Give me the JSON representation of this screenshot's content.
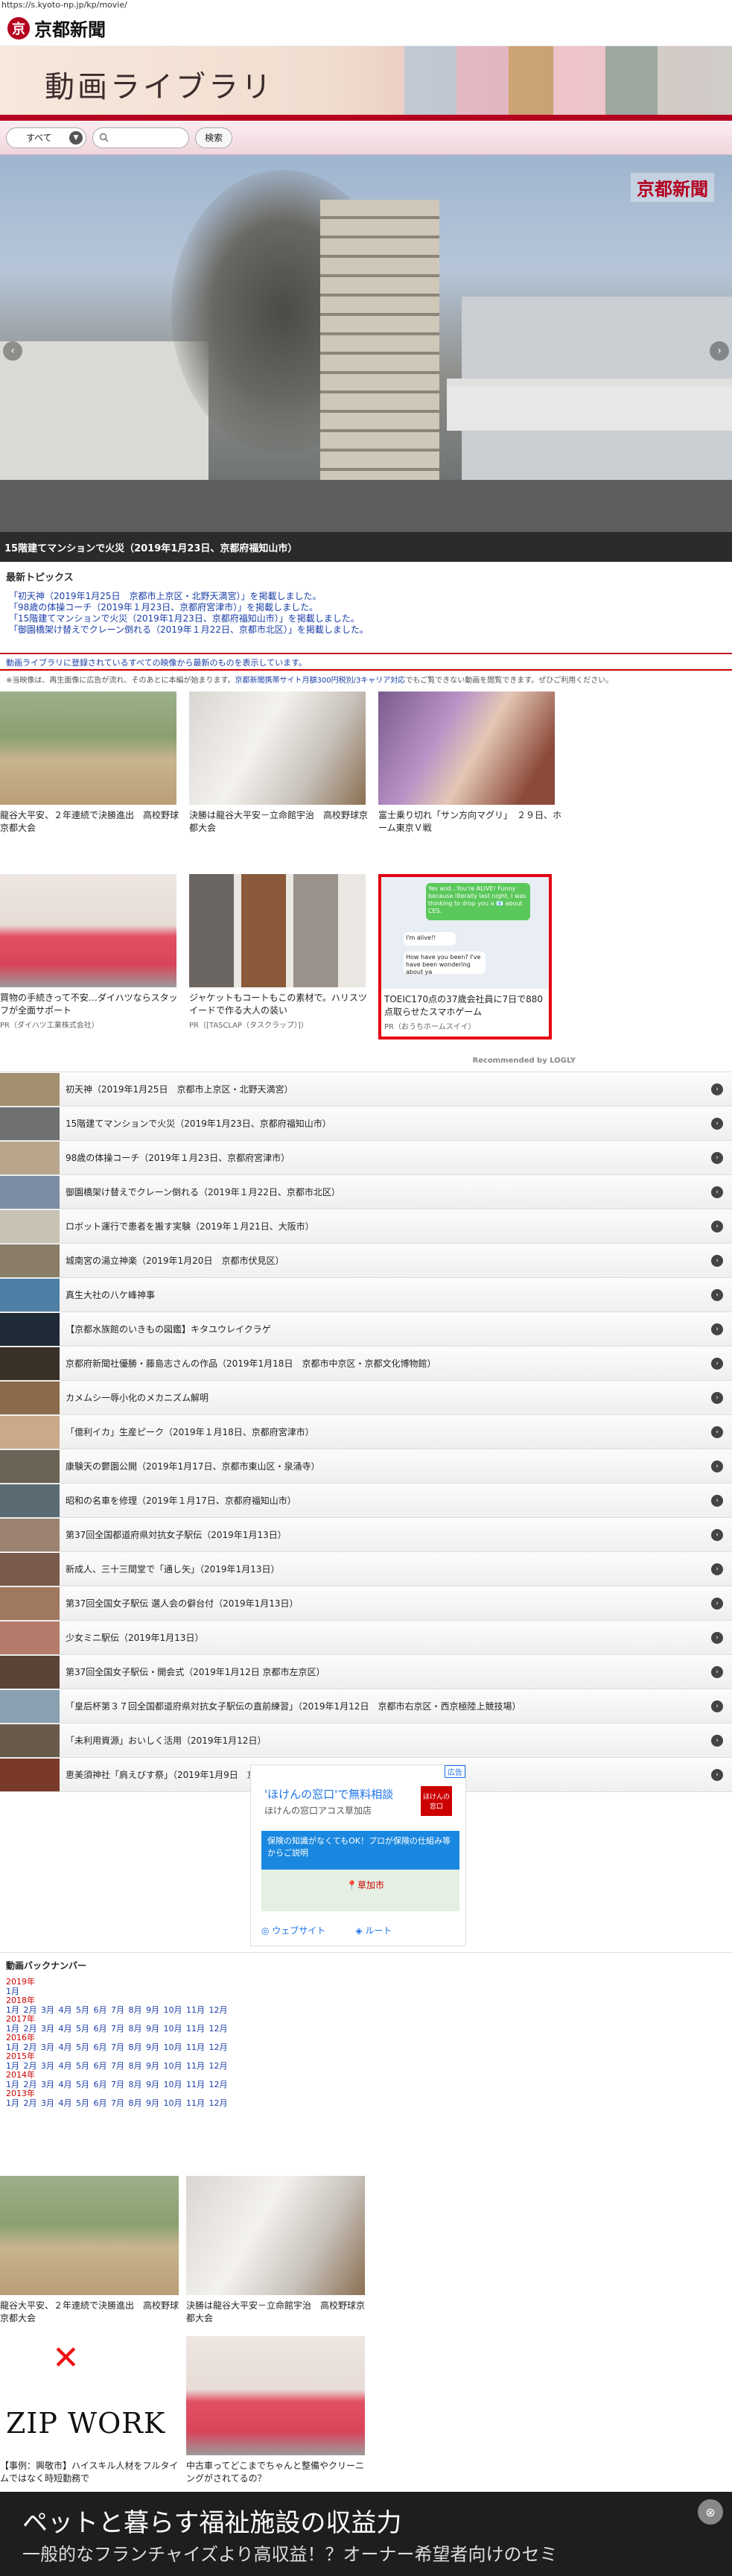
{
  "url": "https://s.kyoto-np.jp/kp/movie/",
  "brand": {
    "mark": "京",
    "name": "京都新聞"
  },
  "banner": {
    "title": "動画ライブラリ"
  },
  "filter": {
    "select_value": "すべて",
    "search_placeholder": "",
    "search_button": "検索"
  },
  "hero": {
    "logo": "京都新聞",
    "caption": "15階建てマンションで火災（2019年1月23日、京都府福知山市）",
    "prev": "‹",
    "next": "›"
  },
  "topics": {
    "title": "最新トピックス",
    "links": [
      "「初天神（2019年1月25日　京都市上京区・北野天満宮）」を掲載しました。",
      "「98歳の体操コーチ（2019年１月23日、京都府宮津市）」を掲載しました。",
      "「15階建てマンションで火災（2019年1月23日、京都府福知山市）」を掲載しました。",
      "「御園橋架け替えでクレーン倒れる（2019年１月22日、京都市北区）」を掲載しました。"
    ]
  },
  "notice": {
    "text": "※当映像は、再生面像に広告が流れ、そのあとに本編が始まります。",
    "link": "京都新聞携帯サイト月額300円税別/3キャリア対応",
    "tail": "でもご覧できない動画を閲覧できます。ぜひご利用ください。"
  },
  "notice_blue": "動画ライブラリに登録されているすべての映像から最新のものを表示しています。",
  "cards": [
    {
      "caption": "龍谷大平安、２年連続で決勝進出　高校野球京都大会",
      "pr": ""
    },
    {
      "caption": "決勝は龍谷大平安－立命館宇治　高校野球京都大会",
      "pr": ""
    },
    {
      "caption": "富士乗り切れ「サン方向マグリ」　２９日、ホーム東京Ｖ戦",
      "pr": ""
    },
    {
      "caption": "買物の手続きって不安…ダイハツならスタッフが全面サポート",
      "pr": "PR（ダイハツ工業株式会社）"
    },
    {
      "caption": "ジャケットもコートもこの素材で。ハリスツイードで作る大人の装い",
      "pr": "PR（[TASCLAP（タスクラップ）]）"
    },
    {
      "caption": "TOEIC170点の37歳会社員に7日で880点取らせたスマホゲーム",
      "pr": "PR（おうちホームスイイ）"
    }
  ],
  "chat_bubbles": [
    "Yes and...You're ALIVE! Funny because literally last night, I was thinking to drop you a 📧 about CES.",
    "I'm alive!!",
    "How have you been? I've have been wondering about ya"
  ],
  "recommended": "Recommended by LOGLY",
  "videos": [
    "初天神（2019年1月25日　京都市上京区・北野天満宮）",
    "15階建てマンションで火災（2019年1月23日、京都府福知山市）",
    "98歳の体操コーチ（2019年１月23日、京都府宮津市）",
    "御園橋架け替えでクレーン倒れる（2019年１月22日、京都市北区）",
    "ロボット運行で患者を搬す実験（2019年１月21日、大阪市）",
    "城南宮の湯立神楽（2019年1月20日　京都市伏見区）",
    "真生大社の八ケ峰神事",
    "【京都水族館のいきもの図鑑】キタユウレイクラゲ",
    "京都府新聞社優勝・藤島志さんの作品（2019年1月18日　京都市中京区・京都文化博物館）",
    "カメムシ一辱小化のメカニズム解明",
    "「億利イカ」生産ピーク（2019年１月18日、京都府宮津市）",
    "康験天の鬱園公開（2019年1月17日、京都市東山区・泉涌寺）",
    "昭和の名車を修理（2019年１月17日、京都府福知山市）",
    "第37回全国都道府県対抗女子駅伝（2019年1月13日）",
    "新成人、三十三間堂で「通し矢」（2019年1月13日）",
    "第37回全国女子駅伝 選人会の僻台付（2019年1月13日）",
    "少女ミニ駅伝（2019年1月13日）",
    "第37回全国女子駅伝・開会式（2019年1月12日 京都市左京区）",
    "「皇后杯第３７回全国都道府県対抗女子駅伝の直前練習」（2019年1月12日　京都市右京区・西京極陸上競技場）",
    "「未利用資源」おいしく活用（2019年1月12日）",
    "恵美須神社「肩えびす祭」（2019年1月9日　京都市東山区）"
  ],
  "google_ad": {
    "tag": "広告",
    "head": "'ほけんの窓口'で無料相談",
    "sub": "ほけんの窓口アコス草加店",
    "blue": "保険の知識がなくてもOK！プロが保険の仕組み等からご説明",
    "pin": "草加市",
    "site": "ウェブサイト",
    "route": "ルート",
    "logo": "ほけんの窓口"
  },
  "backnumber": {
    "title": "動画バックナンバー",
    "years": [
      {
        "year": "2019年",
        "months": "1月"
      },
      {
        "year": "2018年",
        "months": "1月 2月 3月 4月 5月 6月 7月 8月 9月 10月 11月 12月"
      },
      {
        "year": "2017年",
        "months": "1月 2月 3月 4月 5月 6月 7月 8月 9月 10月 11月 12月"
      },
      {
        "year": "2016年",
        "months": "1月 2月 3月 4月 5月 6月 7月 8月 9月 10月 11月 12月"
      },
      {
        "year": "2015年",
        "months": "1月 2月 3月 4月 5月 6月 7月 8月 9月 10月 11月 12月"
      },
      {
        "year": "2014年",
        "months": "1月 2月 3月 4月 5月 6月 7月 8月 9月 10月 11月 12月"
      },
      {
        "year": "2013年",
        "months": "1月 2月 3月 4月 5月 6月 7月 8月 9月 10月 11月 12月"
      }
    ]
  },
  "cards2": [
    {
      "caption": "龍谷大平安、２年連続で決勝進出　高校野球京都大会"
    },
    {
      "caption": "決勝は龍谷大平安－立命館宇治　高校野球京都大会"
    },
    {
      "caption": "【事例：興敬市】ハイスキル人材をフルタイムではなく時短勤務で",
      "logo": "ZIP WORK"
    },
    {
      "caption": "中古車ってどこまでちゃんと整備やクリーニングがされてるの？"
    }
  ],
  "bottom_ad": {
    "line1": "ペットと暮らす福祉施設の収益力",
    "line2": "一般的なフランチャイズより高収益！？オーナー希望者向けのセミ",
    "close": "⊗"
  },
  "colors": {
    "brand_red": "#b5001f",
    "link_blue": "#1a3ea8"
  }
}
